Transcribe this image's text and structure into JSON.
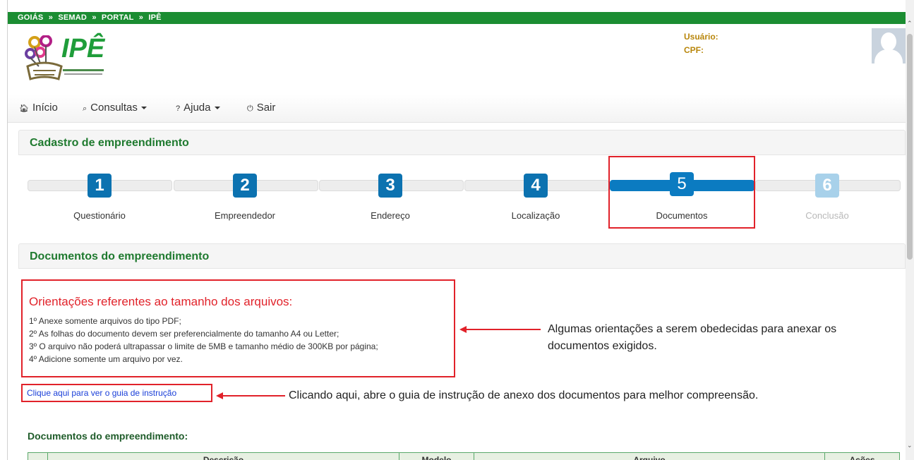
{
  "breadcrumb": [
    "GOIÁS",
    "»",
    "SEMAD",
    "»",
    "PORTAL",
    "»",
    "IPÊ"
  ],
  "brand": {
    "name": "IPÊ"
  },
  "user": {
    "usuario_label": "Usuário:",
    "cpf_label": "CPF:"
  },
  "nav": {
    "inicio": "Início",
    "consultas": "Consultas",
    "ajuda": "Ajuda",
    "sair": "Sair",
    "icons": [
      "home-icon",
      "search-icon",
      "question-icon",
      "power-icon"
    ]
  },
  "cadastro": {
    "title": "Cadastro de empreendimento"
  },
  "wizard": {
    "steps": [
      {
        "num": "1",
        "label": "Questionário"
      },
      {
        "num": "2",
        "label": "Empreendedor"
      },
      {
        "num": "3",
        "label": "Endereço"
      },
      {
        "num": "4",
        "label": "Localização"
      },
      {
        "num": "5",
        "label": "Documentos"
      },
      {
        "num": "6",
        "label": "Conclusão"
      }
    ],
    "active_step": 5
  },
  "documentos": {
    "title": "Documentos do empreendimento"
  },
  "orientacoes": {
    "title": "Orientações referentes ao tamanho dos arquivos:",
    "lines": [
      "1º Anexe somente arquivos do tipo PDF;",
      "2º As folhas do documento devem ser preferencialmente do tamanho A4 ou Letter;",
      "3º O arquivo não poderá ultrapassar o limite de 5MB e tamanho médio de 300KB por página;",
      "4º Adicione somente um arquivo por vez."
    ]
  },
  "guide_link": "Clique aqui para ver o guia de instrução",
  "annotations": {
    "orient_note_1": "Algumas orientações a serem obedecidas para anexar os",
    "orient_note_2": "documentos exigidos.",
    "guide_note": "Clicando aqui, abre o guia de instrução de anexo dos documentos para melhor compreensão."
  },
  "docs_list": {
    "title": "Documentos do empreendimento:",
    "columns": [
      "",
      "Descrição",
      "Modelo",
      "Arquivo",
      "Ações"
    ]
  },
  "colors": {
    "green_bar": "#1b8d32",
    "heading_green": "#1f7a2f",
    "step_blue": "#0c72b0",
    "highlight_red": "#e1222a",
    "link_blue": "#1a3fd8"
  }
}
